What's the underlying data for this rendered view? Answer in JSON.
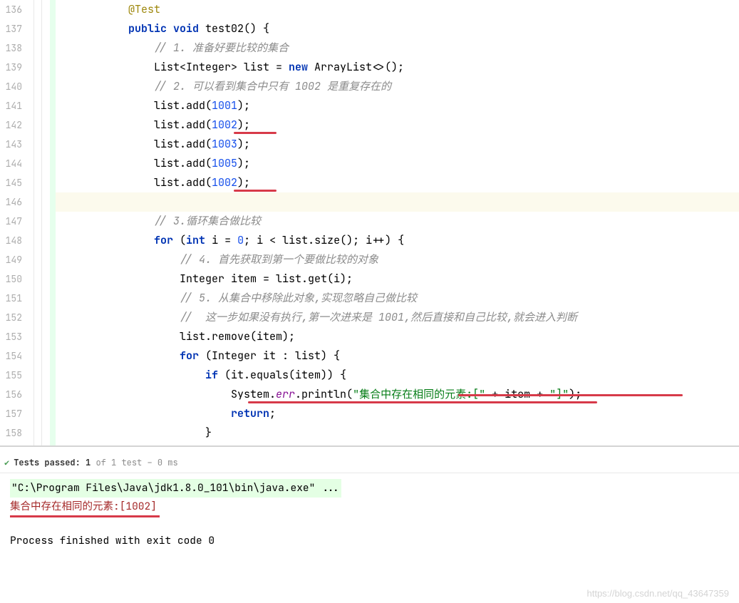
{
  "gutter": {
    "start": 136,
    "end": 158,
    "icon_line": 137
  },
  "code": {
    "lines": [
      {
        "indent": "        ",
        "tokens": [
          {
            "cls": "anno",
            "t": "@Test"
          }
        ]
      },
      {
        "indent": "        ",
        "tokens": [
          {
            "cls": "kw",
            "t": "public void"
          },
          {
            "cls": "plain",
            "t": " test02() {"
          }
        ]
      },
      {
        "indent": "            ",
        "tokens": [
          {
            "cls": "comment",
            "t": "// 1. 准备好要比较的集合"
          }
        ]
      },
      {
        "indent": "            ",
        "tokens": [
          {
            "cls": "plain",
            "t": "List<Integer> list = "
          },
          {
            "cls": "kw",
            "t": "new"
          },
          {
            "cls": "plain",
            "t": " ArrayList<>();"
          }
        ]
      },
      {
        "indent": "            ",
        "tokens": [
          {
            "cls": "comment",
            "t": "// 2. 可以看到集合中只有 1002 是重复存在的"
          }
        ]
      },
      {
        "indent": "            ",
        "tokens": [
          {
            "cls": "plain",
            "t": "list.add("
          },
          {
            "cls": "num",
            "t": "1001"
          },
          {
            "cls": "plain",
            "t": ");"
          }
        ]
      },
      {
        "indent": "            ",
        "tokens": [
          {
            "cls": "plain",
            "t": "list.add("
          },
          {
            "cls": "num",
            "t": "1002"
          },
          {
            "cls": "plain",
            "t": ");"
          }
        ],
        "mark": "red-mark-1"
      },
      {
        "indent": "            ",
        "tokens": [
          {
            "cls": "plain",
            "t": "list.add("
          },
          {
            "cls": "num",
            "t": "1003"
          },
          {
            "cls": "plain",
            "t": ");"
          }
        ]
      },
      {
        "indent": "            ",
        "tokens": [
          {
            "cls": "plain",
            "t": "list.add("
          },
          {
            "cls": "num",
            "t": "1005"
          },
          {
            "cls": "plain",
            "t": ");"
          }
        ]
      },
      {
        "indent": "            ",
        "tokens": [
          {
            "cls": "plain",
            "t": "list.add("
          },
          {
            "cls": "num",
            "t": "1002"
          },
          {
            "cls": "plain",
            "t": ");"
          }
        ],
        "mark": "red-mark-2"
      },
      {
        "indent": "",
        "highlight": true,
        "tokens": []
      },
      {
        "indent": "            ",
        "tokens": [
          {
            "cls": "comment",
            "t": "// 3.循环集合做比较"
          }
        ]
      },
      {
        "indent": "            ",
        "tokens": [
          {
            "cls": "kw",
            "t": "for"
          },
          {
            "cls": "plain",
            "t": " ("
          },
          {
            "cls": "kw",
            "t": "int"
          },
          {
            "cls": "plain",
            "t": " i = "
          },
          {
            "cls": "num",
            "t": "0"
          },
          {
            "cls": "plain",
            "t": "; i < list.size(); i++) {"
          }
        ]
      },
      {
        "indent": "                ",
        "tokens": [
          {
            "cls": "comment",
            "t": "// 4. 首先获取到第一个要做比较的对象"
          }
        ]
      },
      {
        "indent": "                ",
        "tokens": [
          {
            "cls": "plain",
            "t": "Integer item = list.get(i);"
          }
        ]
      },
      {
        "indent": "                ",
        "tokens": [
          {
            "cls": "comment",
            "t": "// 5. 从集合中移除此对象,实现忽略自己做比较"
          }
        ]
      },
      {
        "indent": "                ",
        "tokens": [
          {
            "cls": "comment",
            "t": "//  这一步如果没有执行,第一次进来是 1001,然后直接和自己比较,就会进入判断"
          }
        ]
      },
      {
        "indent": "                ",
        "tokens": [
          {
            "cls": "plain",
            "t": "list.remove(item);"
          }
        ]
      },
      {
        "indent": "                ",
        "tokens": [
          {
            "cls": "kw",
            "t": "for"
          },
          {
            "cls": "plain",
            "t": " (Integer it : list) {"
          }
        ]
      },
      {
        "indent": "                    ",
        "tokens": [
          {
            "cls": "kw",
            "t": "if"
          },
          {
            "cls": "plain",
            "t": " (it.equals(item)) {"
          }
        ]
      },
      {
        "indent": "                        ",
        "tokens": [
          {
            "cls": "plain",
            "t": "System."
          },
          {
            "cls": "err-field",
            "t": "err"
          },
          {
            "cls": "plain",
            "t": ".println("
          },
          {
            "cls": "str",
            "t": "\"集合中存在相同的元素:[\""
          },
          {
            "cls": "plain",
            "t": " + item + "
          },
          {
            "cls": "str",
            "t": "\"]\""
          },
          {
            "cls": "plain",
            "t": ");"
          }
        ],
        "mark2": true
      },
      {
        "indent": "                        ",
        "tokens": [
          {
            "cls": "kw",
            "t": "return"
          },
          {
            "cls": "plain",
            "t": ";"
          }
        ]
      },
      {
        "indent": "                    ",
        "tokens": [
          {
            "cls": "plain",
            "t": "}"
          }
        ]
      }
    ]
  },
  "test_status": {
    "prefix": "Tests passed:",
    "count": "1",
    "suffix": "of 1 test – 0 ms"
  },
  "console": {
    "cmd": "\"C:\\Program Files\\Java\\jdk1.8.0_101\\bin\\java.exe\" ...",
    "err": "集合中存在相同的元素:[1002]",
    "finished": "Process finished with exit code 0"
  },
  "watermark": "https://blog.csdn.net/qq_43647359"
}
